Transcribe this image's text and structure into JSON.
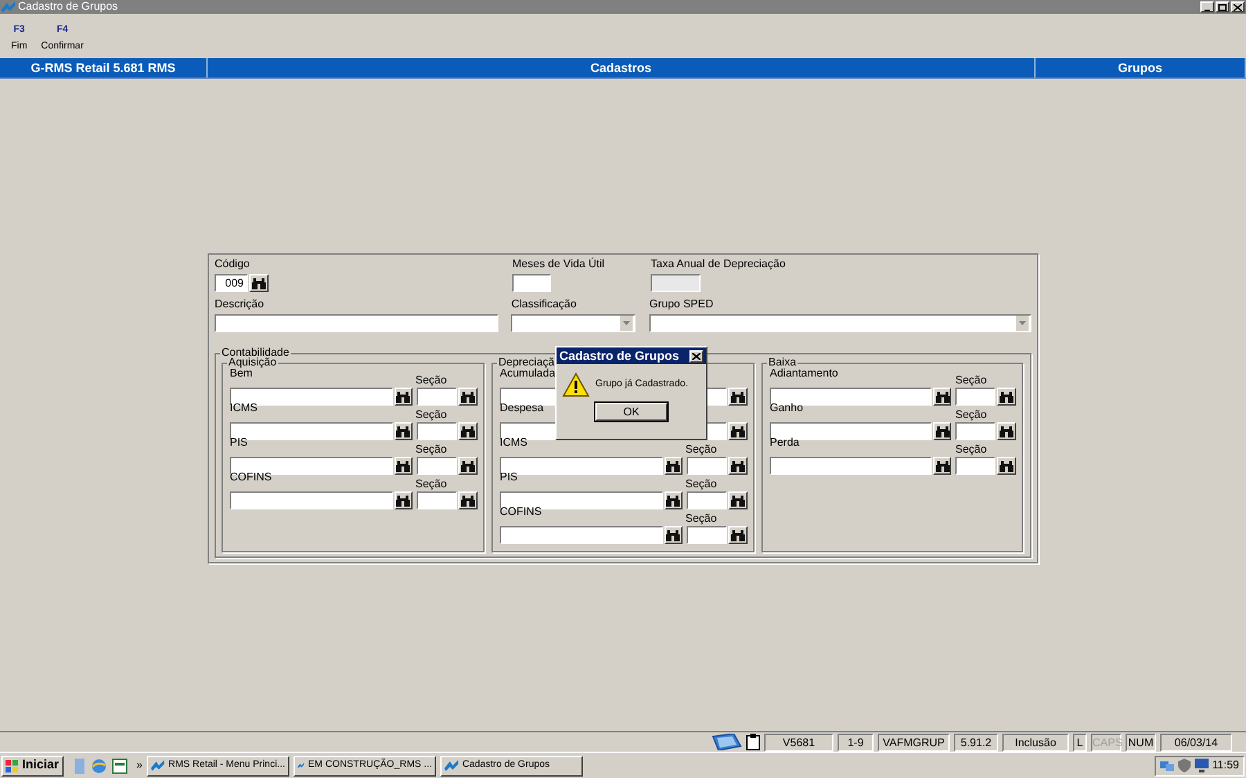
{
  "window": {
    "title": "Cadastro de Grupos"
  },
  "toolbar": [
    {
      "key": "F3",
      "label": "Fim"
    },
    {
      "key": "F4",
      "label": "Confirmar"
    }
  ],
  "header": [
    "G-RMS Retail 5.681 RMS",
    "Cadastros",
    "Grupos"
  ],
  "form": {
    "codigo": {
      "label": "Código",
      "value": "009"
    },
    "meses": {
      "label": "Meses de Vida Útil"
    },
    "taxa": {
      "label": "Taxa Anual de Depreciação",
      "disabled": true
    },
    "descricao": {
      "label": "Descrição"
    },
    "classificacao": {
      "label": "Classificação"
    },
    "grupo_sped": {
      "label": "Grupo SPED"
    }
  },
  "contabilidade": {
    "title": "Contabilidade",
    "groups": [
      {
        "title": "Aquisição",
        "rows": [
          {
            "label": "Bem",
            "section_label": "Seção"
          },
          {
            "label": "ICMS",
            "section_label": "Seção"
          },
          {
            "label": "PIS",
            "section_label": "Seção"
          },
          {
            "label": "COFINS",
            "section_label": "Seção"
          }
        ]
      },
      {
        "title": "Depreciaçã",
        "rows": [
          {
            "label": "Acumulada"
          },
          {
            "label": "Despesa"
          },
          {
            "label": "ICMS",
            "section_label": "Seção"
          },
          {
            "label": "PIS",
            "section_label": "Seção"
          },
          {
            "label": "COFINS",
            "section_label": "Seção"
          }
        ]
      },
      {
        "title": "Baixa",
        "rows": [
          {
            "label": "Adiantamento",
            "section_label": "Seção"
          },
          {
            "label": "Ganho",
            "section_label": "Seção"
          },
          {
            "label": "Perda",
            "section_label": "Seção"
          }
        ]
      }
    ]
  },
  "dialog": {
    "title": "Cadastro de Grupos",
    "message": "Grupo já Cadastrado.",
    "button": "OK"
  },
  "status_bar": [
    {
      "text": "V5681",
      "disabled": false
    },
    {
      "text": "1-9",
      "disabled": false
    },
    {
      "text": "VAFMGRUP",
      "disabled": false
    },
    {
      "text": "5.91.2",
      "disabled": false
    },
    {
      "text": "Inclusão",
      "disabled": false
    },
    {
      "text": "L",
      "disabled": false
    },
    {
      "text": "CAPS",
      "disabled": true
    },
    {
      "text": "NUM",
      "disabled": false
    },
    {
      "text": "06/03/14",
      "disabled": false
    }
  ],
  "taskbar": {
    "start": "Iniciar",
    "more": "»",
    "tasks": [
      "RMS Retail - Menu Princi...",
      "EM CONSTRUÇÃO_RMS ...",
      "Cadastro de Grupos"
    ],
    "clock": "11:59"
  }
}
